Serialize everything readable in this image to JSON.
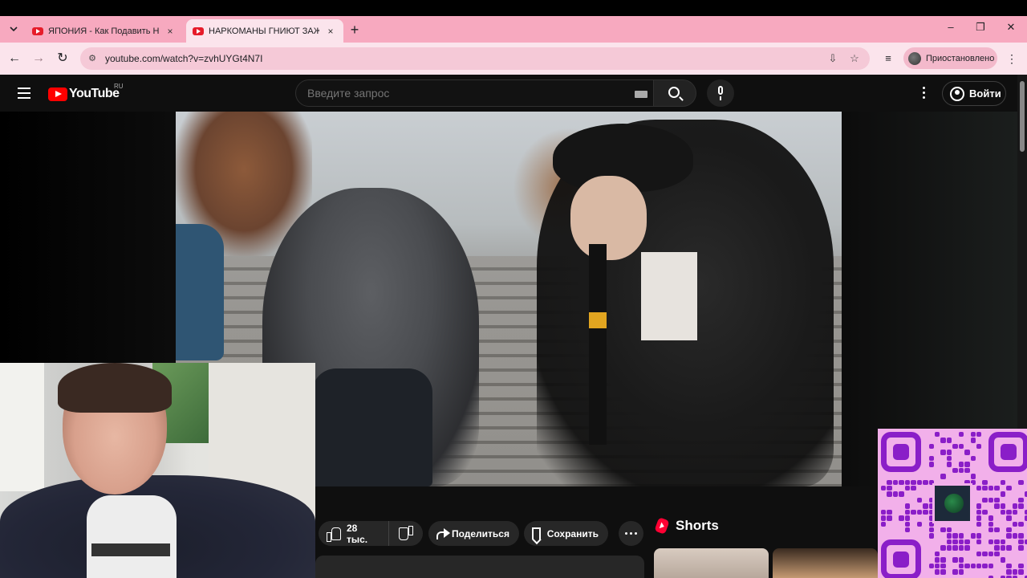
{
  "browser": {
    "tabs": [
      {
        "title": "ЯПОНИЯ - Как Подавить Нац",
        "active": false
      },
      {
        "title": "НАРКОМАНЫ ГНИЮТ ЗАЖИВО",
        "active": true
      }
    ],
    "tab_close": "×",
    "new_tab": "+",
    "window_controls": {
      "minimize": "–",
      "restore": "❐",
      "close": "✕"
    },
    "nav": {
      "back": "←",
      "forward": "→",
      "reload": "↻"
    },
    "url": "youtube.com/watch?v=zvhUYGt4N7I",
    "profile_status": "Приостановлено",
    "icons": [
      "site-settings-icon",
      "install-icon",
      "bookmark-star-icon",
      "media-control-icon"
    ],
    "colors": {
      "tabstrip": "#f7a9bf",
      "toolbar": "#fbe4ec"
    }
  },
  "youtube": {
    "logo_text": "YouTube",
    "region": "RU",
    "search_placeholder": "Введите запрос",
    "signin_label": "Войти"
  },
  "video": {
    "actions": {
      "likes": "28 тыс.",
      "share": "Поделиться",
      "save": "Сохранить"
    }
  },
  "sidebar": {
    "shorts_title": "Shorts"
  },
  "overlays": {
    "webcam": "streamer-webcam",
    "qr": "qr-code-image"
  }
}
